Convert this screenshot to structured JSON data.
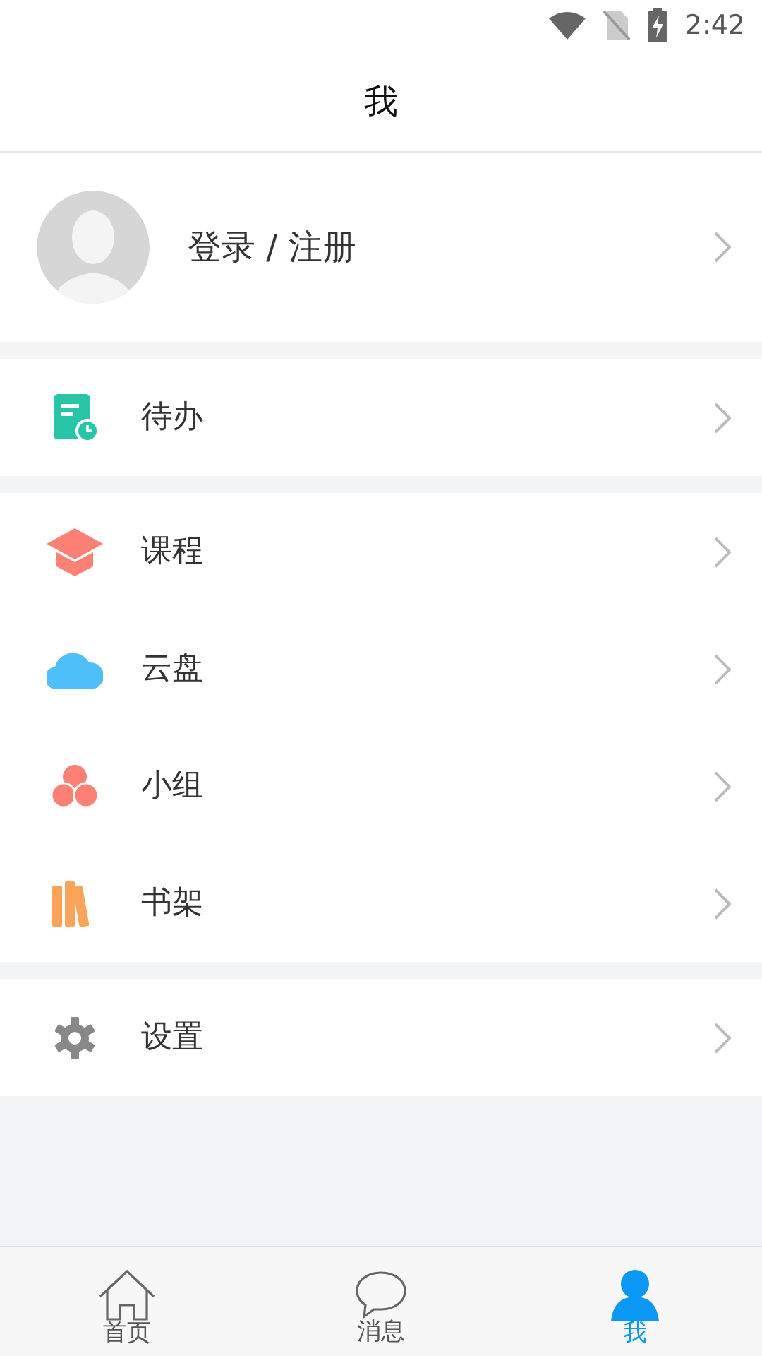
{
  "status_bar": {
    "time": "2:42"
  },
  "title": "我",
  "profile": {
    "label": "登录 / 注册"
  },
  "menu_groups": [
    [
      {
        "kind": "todo",
        "label": "待办"
      }
    ],
    [
      {
        "kind": "course",
        "label": "课程"
      },
      {
        "kind": "cloud",
        "label": "云盘"
      },
      {
        "kind": "group",
        "label": "小组"
      },
      {
        "kind": "books",
        "label": "书架"
      }
    ],
    [
      {
        "kind": "settings",
        "label": "设置"
      }
    ]
  ],
  "tabs": [
    {
      "kind": "home",
      "label": "首页",
      "selected": false
    },
    {
      "kind": "message",
      "label": "消息",
      "selected": false
    },
    {
      "kind": "me",
      "label": "我",
      "selected": true
    }
  ]
}
